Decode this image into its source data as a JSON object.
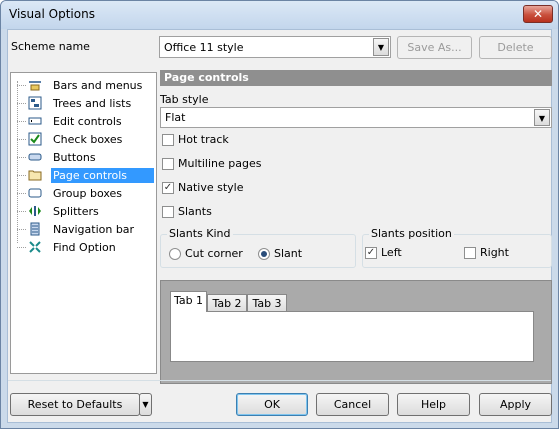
{
  "window": {
    "title": "Visual Options",
    "close_glyph": "✕"
  },
  "scheme": {
    "label": "Scheme name",
    "value": "Office 11 style",
    "save_as": "Save As...",
    "delete": "Delete"
  },
  "tree": {
    "items": [
      {
        "label": "Bars and menus",
        "icon": "bars-menus-icon"
      },
      {
        "label": "Trees and lists",
        "icon": "trees-lists-icon"
      },
      {
        "label": "Edit controls",
        "icon": "edit-controls-icon"
      },
      {
        "label": "Check boxes",
        "icon": "check-box-icon"
      },
      {
        "label": "Buttons",
        "icon": "button-icon"
      },
      {
        "label": "Page controls",
        "icon": "folder-icon",
        "selected": true
      },
      {
        "label": "Group boxes",
        "icon": "group-box-icon"
      },
      {
        "label": "Splitters",
        "icon": "splitter-icon"
      },
      {
        "label": "Navigation bar",
        "icon": "navigation-bar-icon"
      },
      {
        "label": "Find Option",
        "icon": "find-option-icon"
      }
    ]
  },
  "panel": {
    "header": "Page controls",
    "tab_style_label": "Tab style",
    "tab_style_value": "Flat",
    "options": [
      {
        "label": "Hot track",
        "checked": false
      },
      {
        "label": "Multiline pages",
        "checked": false
      },
      {
        "label": "Native style",
        "checked": true
      },
      {
        "label": "Slants",
        "checked": false
      }
    ],
    "slants_kind": {
      "label": "Slants Kind",
      "options": [
        {
          "label": "Cut corner",
          "selected": false
        },
        {
          "label": "Slant",
          "selected": true
        }
      ]
    },
    "slants_position": {
      "label": "Slants position",
      "options": [
        {
          "label": "Left",
          "checked": true
        },
        {
          "label": "Right",
          "checked": false
        }
      ]
    },
    "preview_tabs": [
      "Tab 1",
      "Tab 2",
      "Tab 3"
    ]
  },
  "footer": {
    "reset": "Reset to Defaults",
    "ok": "OK",
    "cancel": "Cancel",
    "help": "Help",
    "apply": "Apply"
  },
  "colors": {
    "selection": "#3399ff",
    "header_bg": "#8f8f8f",
    "frame": "#cbdaea"
  }
}
